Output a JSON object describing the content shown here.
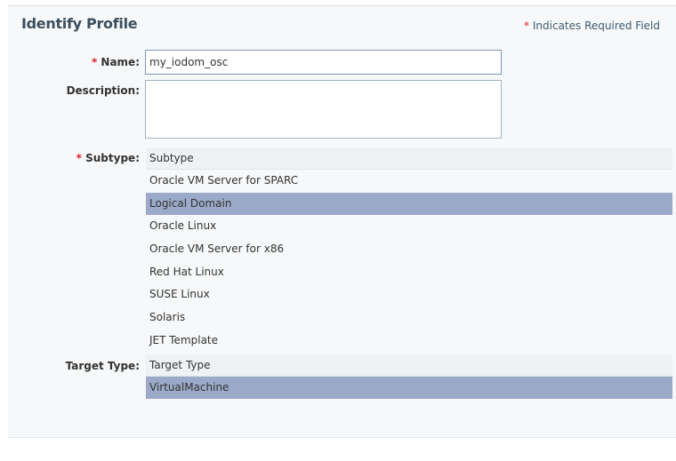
{
  "panel": {
    "title": "Identify Profile",
    "required_note_star": "*",
    "required_note_text": "Indicates Required Field"
  },
  "fields": {
    "name": {
      "label": "Name:",
      "required_star": "*",
      "value": "my_iodom_osc"
    },
    "description": {
      "label": "Description:",
      "value": ""
    },
    "subtype": {
      "label": "Subtype:",
      "required_star": "*",
      "header": "Subtype",
      "options": [
        "Oracle VM Server for SPARC",
        "Logical Domain",
        "Oracle Linux",
        "Oracle VM Server for x86",
        "Red Hat Linux",
        "SUSE Linux",
        "Solaris",
        "JET Template"
      ],
      "selected": "Logical Domain"
    },
    "target_type": {
      "label": "Target Type:",
      "header": "Target Type",
      "options": [
        "VirtualMachine"
      ],
      "selected": "VirtualMachine"
    }
  },
  "colors": {
    "selected_row": "#9aaac8",
    "required_star": "#d8252c",
    "panel_bg": "#f7f8f9"
  }
}
